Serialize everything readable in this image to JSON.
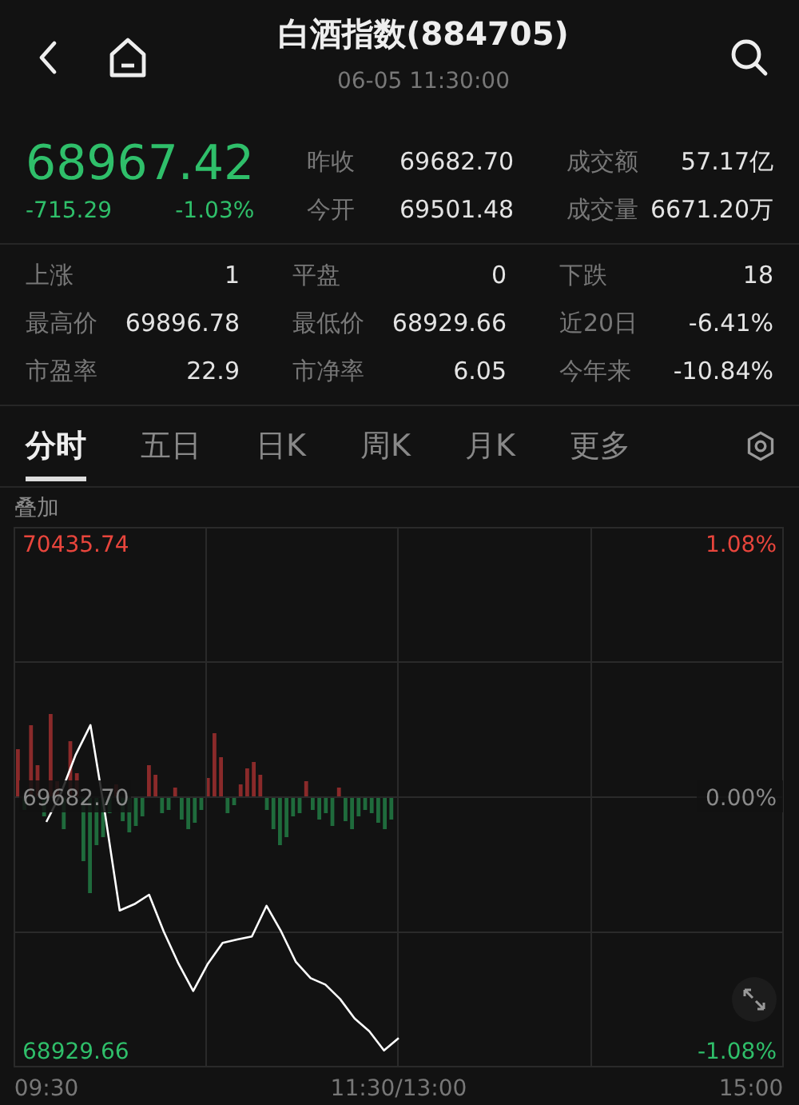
{
  "header": {
    "title": "白酒指数(884705)",
    "datetime": "06-05 11:30:00"
  },
  "quote": {
    "price": "68967.42",
    "change": "-715.29",
    "change_pct": "-1.03%",
    "fields": [
      {
        "label": "昨收",
        "value": "69682.70"
      },
      {
        "label": "成交额",
        "value": "57.17亿"
      },
      {
        "label": "今开",
        "value": "69501.48"
      },
      {
        "label": "成交量",
        "value": "6671.20万"
      }
    ]
  },
  "stats": [
    {
      "label": "上涨",
      "value": "1"
    },
    {
      "label": "平盘",
      "value": "0"
    },
    {
      "label": "下跌",
      "value": "18"
    },
    {
      "label": "最高价",
      "value": "69896.78"
    },
    {
      "label": "最低价",
      "value": "68929.66"
    },
    {
      "label": "近20日",
      "value": "-6.41%"
    },
    {
      "label": "市盈率",
      "value": "22.9"
    },
    {
      "label": "市净率",
      "value": "6.05"
    },
    {
      "label": "今年来",
      "value": "-10.84%"
    }
  ],
  "tabs": [
    {
      "label": "分时",
      "selected": true
    },
    {
      "label": "五日",
      "selected": false
    },
    {
      "label": "日K",
      "selected": false
    },
    {
      "label": "周K",
      "selected": false
    },
    {
      "label": "月K",
      "selected": false
    },
    {
      "label": "更多",
      "selected": false
    }
  ],
  "overlay_button": "叠加",
  "chart": {
    "right_labels": [
      "1.08%",
      "0.00%",
      "-1.08%"
    ],
    "chart_data": {
      "type": "line",
      "categories": [
        "09:30",
        null,
        null,
        null,
        null,
        null,
        null,
        null,
        null,
        null,
        null,
        null,
        null,
        null,
        null,
        null,
        null,
        null,
        null,
        null,
        null,
        null,
        null,
        null,
        "11:30/13:00",
        null,
        null,
        null,
        null,
        null,
        null,
        null,
        null,
        null,
        null,
        null,
        null,
        null,
        null,
        null,
        null,
        null,
        null,
        null,
        null,
        null,
        null,
        null,
        "15:00"
      ],
      "series": [
        {
          "color": "#ffffff",
          "values": [
            69609,
            69695,
            69809,
            69897,
            69632,
            69346,
            69365,
            69393,
            69283,
            69188,
            69107,
            69188,
            69250,
            69260,
            69269,
            69360,
            69283,
            69193,
            69145,
            69126,
            69083,
            69025,
            68987,
            68930,
            68967,
            null,
            null,
            null,
            null,
            null,
            null,
            null,
            null,
            null,
            null,
            null,
            null,
            null,
            null,
            null,
            null,
            null,
            null,
            null,
            null,
            null,
            null,
            null,
            null
          ]
        }
      ],
      "ylim": [
        68929.66,
        70435.74
      ],
      "yticks": [
        {
          "value": 70435.74,
          "label": "70435.74"
        },
        {
          "value": 69682.7,
          "label": "69682.70"
        },
        {
          "value": 68929.66,
          "label": "68929.66"
        }
      ]
    }
  }
}
